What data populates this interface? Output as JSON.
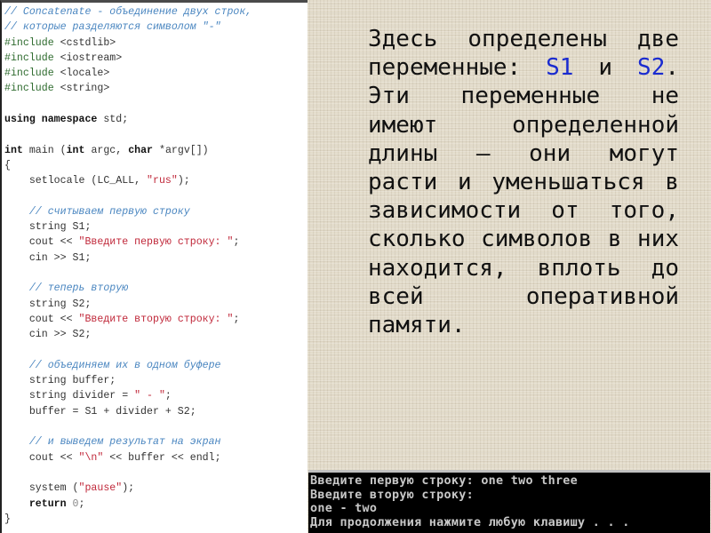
{
  "code_editor": {
    "lines": [
      [
        {
          "t": "comment",
          "v": "// Concatenate - объединение двух строк,"
        }
      ],
      [
        {
          "t": "comment",
          "v": "// которые разделяются символом \"-\""
        }
      ],
      [
        {
          "t": "pre",
          "v": "#include "
        },
        {
          "t": "plain",
          "v": "<cstdlib>"
        }
      ],
      [
        {
          "t": "pre",
          "v": "#include "
        },
        {
          "t": "plain",
          "v": "<iostream>"
        }
      ],
      [
        {
          "t": "pre",
          "v": "#include "
        },
        {
          "t": "plain",
          "v": "<locale>"
        }
      ],
      [
        {
          "t": "pre",
          "v": "#include "
        },
        {
          "t": "plain",
          "v": "<string>"
        }
      ],
      [],
      [
        {
          "t": "kw",
          "v": "using namespace "
        },
        {
          "t": "plain",
          "v": "std;"
        }
      ],
      [],
      [
        {
          "t": "kw",
          "v": "int "
        },
        {
          "t": "plain",
          "v": "main ("
        },
        {
          "t": "kw",
          "v": "int "
        },
        {
          "t": "plain",
          "v": "argc, "
        },
        {
          "t": "kw",
          "v": "char "
        },
        {
          "t": "plain",
          "v": "*argv[])"
        }
      ],
      [
        {
          "t": "plain",
          "v": "{"
        }
      ],
      [
        {
          "t": "plain",
          "v": "    setlocale (LC_ALL, "
        },
        {
          "t": "str",
          "v": "\"rus\""
        },
        {
          "t": "plain",
          "v": ");"
        }
      ],
      [],
      [
        {
          "t": "comment",
          "v": "    // считываем первую строку"
        }
      ],
      [
        {
          "t": "plain",
          "v": "    string S1;"
        }
      ],
      [
        {
          "t": "plain",
          "v": "    cout << "
        },
        {
          "t": "str",
          "v": "\"Введите первую строку: \""
        },
        {
          "t": "plain",
          "v": ";"
        }
      ],
      [
        {
          "t": "plain",
          "v": "    cin >> S1;"
        }
      ],
      [],
      [
        {
          "t": "comment",
          "v": "    // теперь вторую"
        }
      ],
      [
        {
          "t": "plain",
          "v": "    string S2;"
        }
      ],
      [
        {
          "t": "plain",
          "v": "    cout << "
        },
        {
          "t": "str",
          "v": "\"Введите вторую строку: \""
        },
        {
          "t": "plain",
          "v": ";"
        }
      ],
      [
        {
          "t": "plain",
          "v": "    cin >> S2;"
        }
      ],
      [],
      [
        {
          "t": "comment",
          "v": "    // объединяем их в одном буфере"
        }
      ],
      [
        {
          "t": "plain",
          "v": "    string buffer;"
        }
      ],
      [
        {
          "t": "plain",
          "v": "    string divider = "
        },
        {
          "t": "str",
          "v": "\" - \""
        },
        {
          "t": "plain",
          "v": ";"
        }
      ],
      [
        {
          "t": "plain",
          "v": "    buffer = S1 + divider + S2;"
        }
      ],
      [],
      [
        {
          "t": "comment",
          "v": "    // и выведем результат на экран"
        }
      ],
      [
        {
          "t": "plain",
          "v": "    cout << "
        },
        {
          "t": "str",
          "v": "\"\\n\""
        },
        {
          "t": "plain",
          "v": " << buffer << endl;"
        }
      ],
      [],
      [
        {
          "t": "plain",
          "v": "    system ("
        },
        {
          "t": "str",
          "v": "\"pause\""
        },
        {
          "t": "plain",
          "v": ");"
        }
      ],
      [
        {
          "t": "kw",
          "v": "    return "
        },
        {
          "t": "num",
          "v": "0"
        },
        {
          "t": "plain",
          "v": ";"
        }
      ],
      [
        {
          "t": "plain",
          "v": "}"
        }
      ]
    ]
  },
  "explanation": {
    "lines": [
      [
        {
          "v": "Здесь определены две"
        }
      ],
      [
        {
          "v": "переменные: "
        },
        {
          "v": "S1",
          "var": true
        },
        {
          "v": " и "
        },
        {
          "v": "S2",
          "var": true
        },
        {
          "v": "."
        }
      ],
      [
        {
          "v": "Эти переменные не"
        }
      ],
      [
        {
          "v": "имеют определенной"
        }
      ],
      [
        {
          "v": "длины – они могут"
        }
      ],
      [
        {
          "v": "расти и уменьшаться в"
        }
      ],
      [
        {
          "v": "зависимости от того,"
        }
      ],
      [
        {
          "v": "сколько символов в них"
        }
      ],
      [
        {
          "v": "находится, вплоть до"
        }
      ],
      [
        {
          "v": "всей оперативной"
        }
      ],
      [
        {
          "v": "памяти."
        }
      ]
    ]
  },
  "console_output": {
    "lines": [
      "Введите первую строку: one two three",
      "Введите вторую строку:",
      "one - two",
      "Для продолжения нажмите любую клавишу . . ."
    ]
  },
  "colors": {
    "comment": "#4a86c0",
    "preprocessor": "#2e6b2e",
    "string": "#c0283a",
    "variable_highlight": "#1a2bd0",
    "console_bg": "#000000",
    "console_text": "#c8c8c8"
  }
}
